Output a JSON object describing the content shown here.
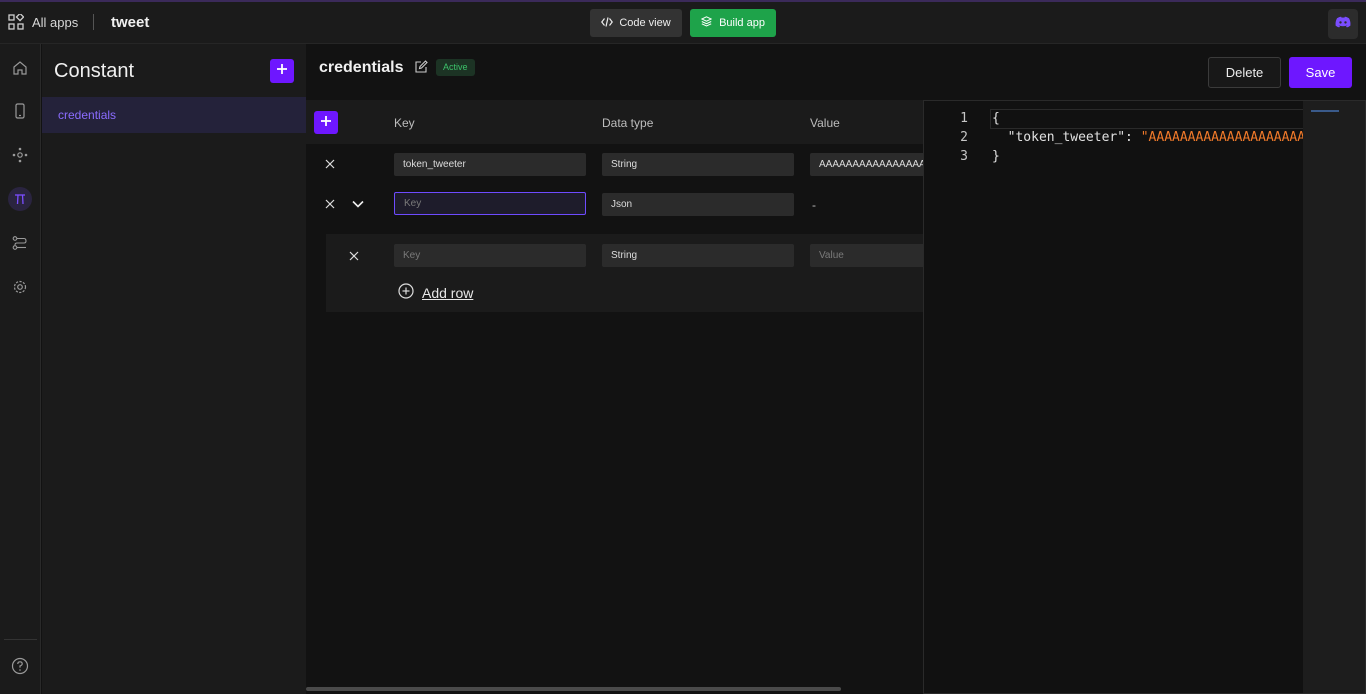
{
  "topbar": {
    "all_apps_label": "All apps",
    "app_name": "tweet",
    "code_view_label": "Code view",
    "build_app_label": "Build app"
  },
  "sidebar": {
    "title": "Constant",
    "items": [
      {
        "label": "credentials"
      }
    ]
  },
  "main": {
    "title": "credentials",
    "status": "Active",
    "delete_label": "Delete",
    "save_label": "Save",
    "columns": {
      "key": "Key",
      "data_type": "Data type",
      "value": "Value"
    },
    "rows": [
      {
        "key": "token_tweeter",
        "data_type": "String",
        "value": "AAAAAAAAAAAAAAAAAAAAAAAA"
      },
      {
        "key_placeholder": "Key",
        "data_type": "Json",
        "value": "-"
      }
    ],
    "nested_row": {
      "key_placeholder": "Key",
      "data_type": "String",
      "value_placeholder": "Value"
    },
    "add_row_label": "Add row"
  },
  "editor": {
    "line_numbers": [
      "1",
      "2",
      "3"
    ],
    "lines": {
      "open": "{",
      "key_part": "  \"token_tweeter\": ",
      "value_part": "\"AAAAAAAAAAAAAAAAAAAAAAAA",
      "close": "}"
    }
  },
  "colors": {
    "accent": "#6e17ff",
    "build_green": "#1ea34a",
    "string_orange": "#f07a2a",
    "status_green": "#3cc26a"
  },
  "icons": [
    "grid-apps-icon",
    "code-icon",
    "layers-icon",
    "discord-icon",
    "home-icon",
    "phone-icon",
    "workflow-icon",
    "pi-constant-icon",
    "flow-icon",
    "settings-icon",
    "help-icon",
    "edit-icon",
    "plus-icon",
    "close-icon",
    "chevron-down-icon",
    "add-circle-icon"
  ]
}
